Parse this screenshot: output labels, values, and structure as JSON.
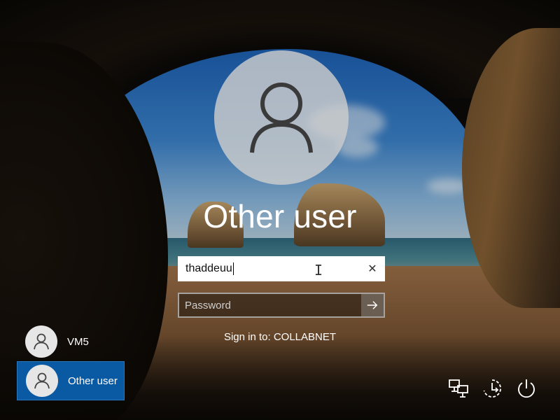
{
  "login": {
    "title": "Other user",
    "username_value": "thaddeuu",
    "password_placeholder": "Password",
    "signin_domain": "Sign in to: COLLABNET"
  },
  "accounts": [
    {
      "label": "VM5",
      "selected": false
    },
    {
      "label": "Other user",
      "selected": true
    }
  ],
  "icons": {
    "large_avatar": "user-icon",
    "clear": "close-icon",
    "submit": "arrow-right-icon",
    "network": "network-icon",
    "ease_of_access": "ease-of-access-icon",
    "power": "power-icon"
  },
  "colors": {
    "selected_account": "#0a5aa3",
    "text": "#ffffff"
  }
}
